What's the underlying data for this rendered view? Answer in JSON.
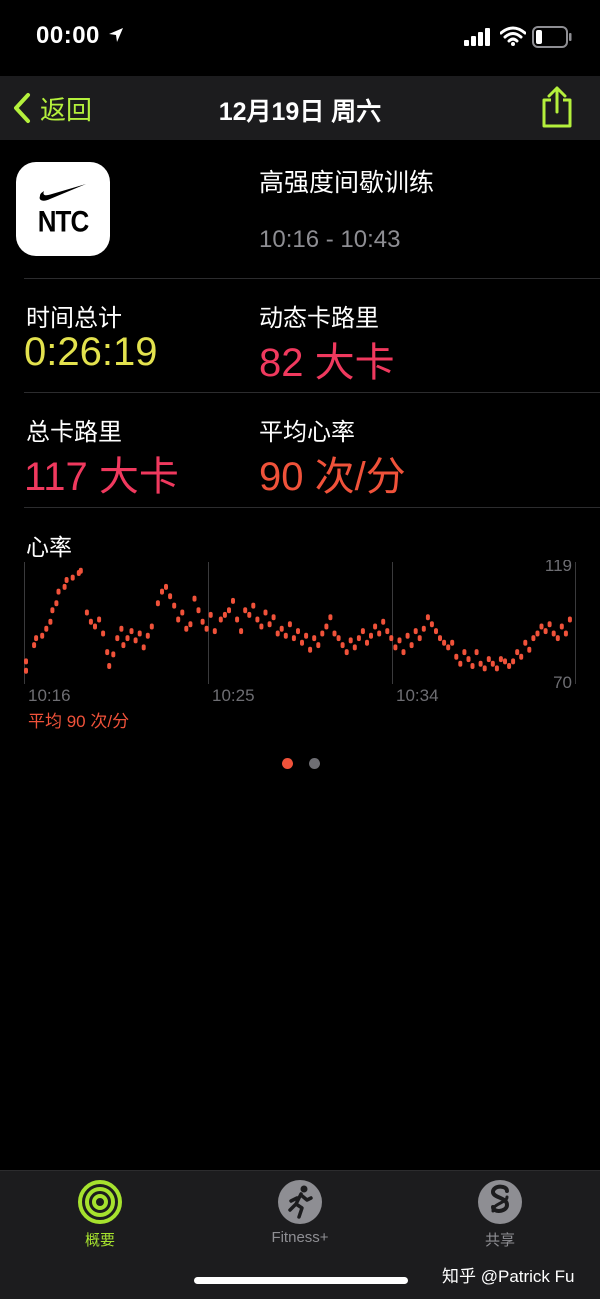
{
  "status": {
    "time": "00:00"
  },
  "nav": {
    "back_label": "返回",
    "title": "12月19日 周六"
  },
  "workout": {
    "app_icon_text": "NTC",
    "name": "高强度间歇训练",
    "time_range": "10:16 - 10:43"
  },
  "metrics": [
    {
      "label": "时间总计",
      "value": "0:26:19"
    },
    {
      "label": "动态卡路里",
      "value": "82 大卡"
    },
    {
      "label": "总卡路里",
      "value": "117 大卡"
    },
    {
      "label": "平均心率",
      "value": "90 次/分"
    }
  ],
  "heart_rate": {
    "title": "心率",
    "average_label": "平均 90 次/分"
  },
  "chart_data": {
    "type": "scatter",
    "title": "",
    "xlabel": "",
    "ylabel": "",
    "x_tick_labels": [
      "10:16",
      "10:25",
      "10:34"
    ],
    "y_tick_labels": [
      "119",
      "70"
    ],
    "ylim": [
      70,
      119
    ],
    "xlim_minutes": [
      0,
      27
    ],
    "color": "#f0523a",
    "points_minute_bpm": [
      [
        0.0,
        74
      ],
      [
        0.0,
        78
      ],
      [
        0.4,
        85
      ],
      [
        0.5,
        88
      ],
      [
        0.8,
        89
      ],
      [
        1.0,
        92
      ],
      [
        1.2,
        95
      ],
      [
        1.3,
        100
      ],
      [
        1.5,
        103
      ],
      [
        1.6,
        108
      ],
      [
        1.9,
        110
      ],
      [
        2.0,
        113
      ],
      [
        2.3,
        114
      ],
      [
        2.6,
        116
      ],
      [
        2.7,
        117
      ],
      [
        3.0,
        99
      ],
      [
        3.2,
        95
      ],
      [
        3.4,
        93
      ],
      [
        3.6,
        96
      ],
      [
        3.8,
        90
      ],
      [
        4.0,
        82
      ],
      [
        4.1,
        76
      ],
      [
        4.3,
        81
      ],
      [
        4.5,
        88
      ],
      [
        4.7,
        92
      ],
      [
        4.8,
        85
      ],
      [
        5.0,
        88
      ],
      [
        5.2,
        91
      ],
      [
        5.4,
        87
      ],
      [
        5.6,
        90
      ],
      [
        5.8,
        84
      ],
      [
        6.0,
        89
      ],
      [
        6.2,
        93
      ],
      [
        6.5,
        103
      ],
      [
        6.7,
        108
      ],
      [
        6.9,
        110
      ],
      [
        7.1,
        106
      ],
      [
        7.3,
        102
      ],
      [
        7.5,
        96
      ],
      [
        7.7,
        99
      ],
      [
        7.9,
        92
      ],
      [
        8.1,
        94
      ],
      [
        8.3,
        105
      ],
      [
        8.5,
        100
      ],
      [
        8.7,
        95
      ],
      [
        8.9,
        92
      ],
      [
        9.1,
        98
      ],
      [
        9.3,
        91
      ],
      [
        9.6,
        96
      ],
      [
        9.8,
        98
      ],
      [
        10.0,
        100
      ],
      [
        10.2,
        104
      ],
      [
        10.4,
        96
      ],
      [
        10.6,
        91
      ],
      [
        10.8,
        100
      ],
      [
        11.0,
        98
      ],
      [
        11.2,
        102
      ],
      [
        11.4,
        96
      ],
      [
        11.6,
        93
      ],
      [
        11.8,
        99
      ],
      [
        12.0,
        94
      ],
      [
        12.2,
        97
      ],
      [
        12.4,
        90
      ],
      [
        12.6,
        92
      ],
      [
        12.8,
        89
      ],
      [
        13.0,
        94
      ],
      [
        13.2,
        88
      ],
      [
        13.4,
        91
      ],
      [
        13.6,
        86
      ],
      [
        13.8,
        89
      ],
      [
        14.0,
        83
      ],
      [
        14.2,
        88
      ],
      [
        14.4,
        85
      ],
      [
        14.6,
        90
      ],
      [
        14.8,
        93
      ],
      [
        15.0,
        97
      ],
      [
        15.2,
        90
      ],
      [
        15.4,
        88
      ],
      [
        15.6,
        85
      ],
      [
        15.8,
        82
      ],
      [
        16.0,
        87
      ],
      [
        16.2,
        84
      ],
      [
        16.4,
        88
      ],
      [
        16.6,
        91
      ],
      [
        16.8,
        86
      ],
      [
        17.0,
        89
      ],
      [
        17.2,
        93
      ],
      [
        17.4,
        90
      ],
      [
        17.6,
        95
      ],
      [
        17.8,
        91
      ],
      [
        18.0,
        88
      ],
      [
        18.2,
        84
      ],
      [
        18.4,
        87
      ],
      [
        18.6,
        82
      ],
      [
        18.8,
        89
      ],
      [
        19.0,
        85
      ],
      [
        19.2,
        91
      ],
      [
        19.4,
        88
      ],
      [
        19.6,
        92
      ],
      [
        19.8,
        97
      ],
      [
        20.0,
        94
      ],
      [
        20.2,
        91
      ],
      [
        20.4,
        88
      ],
      [
        20.6,
        86
      ],
      [
        20.8,
        84
      ],
      [
        21.0,
        86
      ],
      [
        21.2,
        80
      ],
      [
        21.4,
        77
      ],
      [
        21.6,
        82
      ],
      [
        21.8,
        79
      ],
      [
        22.0,
        76
      ],
      [
        22.2,
        82
      ],
      [
        22.4,
        77
      ],
      [
        22.6,
        75
      ],
      [
        22.8,
        79
      ],
      [
        23.0,
        77
      ],
      [
        23.2,
        75
      ],
      [
        23.4,
        79
      ],
      [
        23.6,
        78
      ],
      [
        23.8,
        76
      ],
      [
        24.0,
        78
      ],
      [
        24.2,
        82
      ],
      [
        24.4,
        80
      ],
      [
        24.6,
        86
      ],
      [
        24.8,
        83
      ],
      [
        25.0,
        88
      ],
      [
        25.2,
        90
      ],
      [
        25.4,
        93
      ],
      [
        25.6,
        91
      ],
      [
        25.8,
        94
      ],
      [
        26.0,
        90
      ],
      [
        26.2,
        88
      ],
      [
        26.4,
        93
      ],
      [
        26.6,
        90
      ],
      [
        26.8,
        96
      ]
    ]
  },
  "page_indicator": {
    "count": 2,
    "active_index": 0,
    "active_color": "#f0523a",
    "inactive_color": "#6e6e73"
  },
  "tabs": [
    {
      "label": "概要",
      "icon": "activity-rings-icon",
      "active": true,
      "color": "#a6e22e"
    },
    {
      "label": "Fitness+",
      "icon": "fitness-runner-icon",
      "active": false,
      "color": "#8e8e93"
    },
    {
      "label": "共享",
      "icon": "sharing-icon",
      "active": false,
      "color": "#8e8e93"
    }
  ],
  "watermark": "知乎 @Patrick Fu"
}
